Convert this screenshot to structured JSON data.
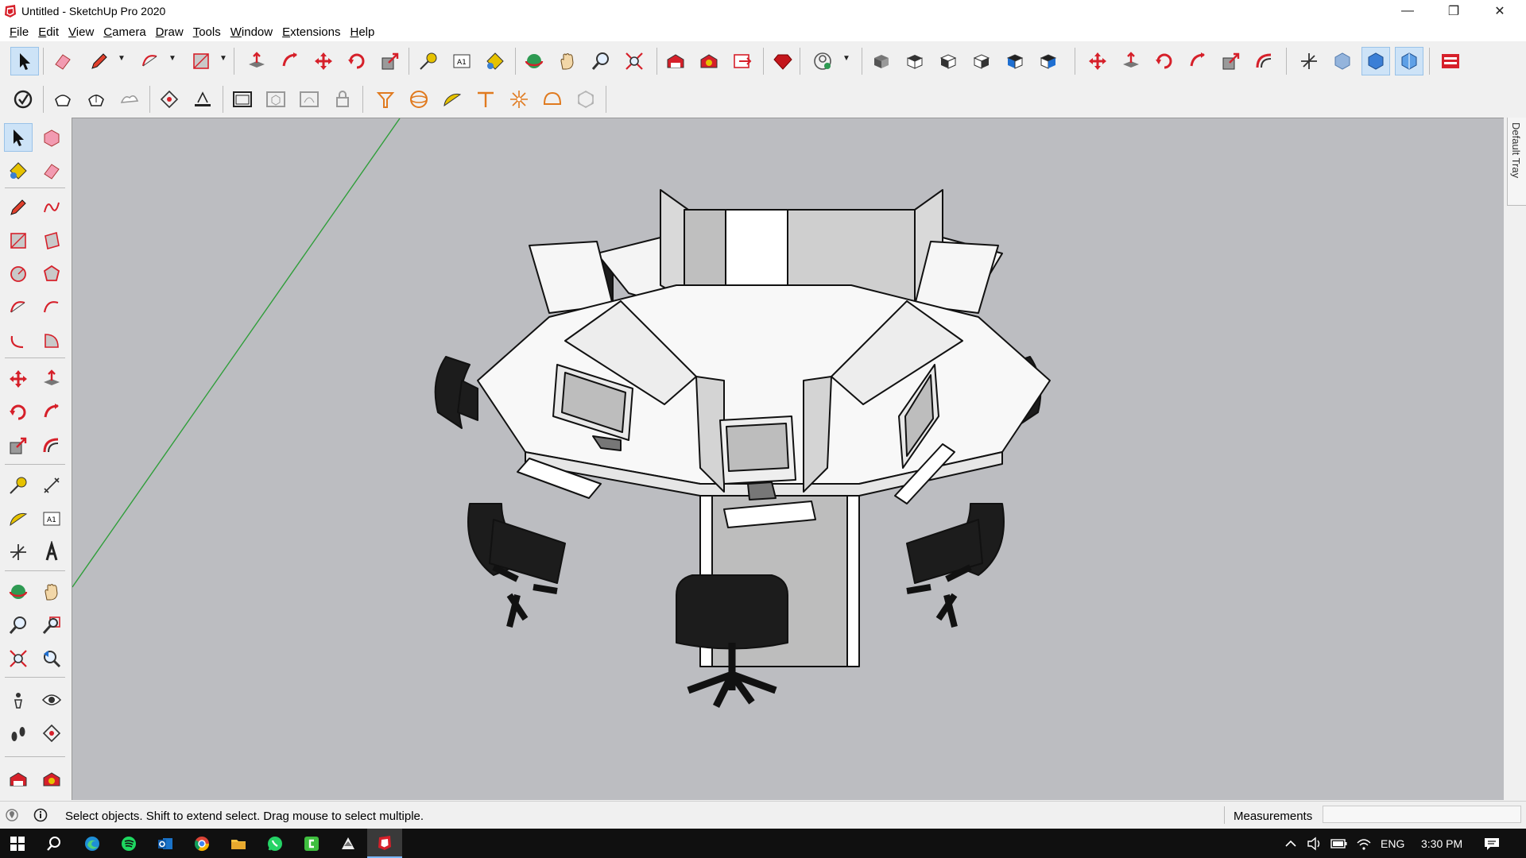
{
  "window": {
    "title": "Untitled - SketchUp Pro 2020",
    "minimize_glyph": "—",
    "restore_glyph": "❐",
    "close_glyph": "✕"
  },
  "menu": [
    "File",
    "Edit",
    "View",
    "Camera",
    "Draw",
    "Tools",
    "Window",
    "Extensions",
    "Help"
  ],
  "tray": {
    "label": "Default Tray"
  },
  "status": {
    "hint": "Select objects. Shift to extend select. Drag mouse to select multiple.",
    "measurements_label": "Measurements",
    "measurements_value": ""
  },
  "taskbar": {
    "language": "ENG",
    "time": "3:30 PM"
  },
  "colors": {
    "accent_red": "#d6202a",
    "viewport_bg": "#bcbdc1",
    "axis_green": "#2f9e3a",
    "orange_tool": "#e07a1f"
  },
  "icons": {
    "top_row_1": [
      "select-icon",
      "eraser-icon",
      "pencil-icon",
      "arc-icon",
      "rectangle-icon",
      "push-pull-icon",
      "follow-me-icon",
      "move-icon",
      "rotate-icon",
      "scale-icon",
      "tape-measure-icon",
      "text-icon",
      "paint-bucket-icon",
      "orbit-icon",
      "pan-icon",
      "zoom-icon",
      "zoom-extents-icon",
      "warehouse-icon",
      "extension-warehouse-icon",
      "send-to-layout-icon",
      "ruby-icon",
      "profile-icon",
      "view-iso-icon",
      "view-top-icon",
      "view-front-icon",
      "view-right-icon",
      "view-back-icon",
      "view-left-icon",
      "move-red-icon",
      "push-pull-red-icon",
      "rotate-red-icon",
      "follow-me-red-icon",
      "scale-red-icon",
      "offset-red-icon",
      "axes-icon",
      "xray-icon",
      "shaded-icon",
      "textured-icon",
      "layout-icon"
    ],
    "top_row_2": [
      "style-icon",
      "sandbox-smoove-icon",
      "sandbox-stamp-icon",
      "sandbox-drape-icon",
      "section-plane-icon",
      "section-cut-icon",
      "window-icon",
      "component-icon",
      "group-icon",
      "lock-icon",
      "advanced-camera-icon",
      "sphere-icon",
      "protractor-icon",
      "tee-icon",
      "light-icon",
      "dome-icon",
      "cube-icon"
    ],
    "left": [
      "select-icon",
      "make-component-icon",
      "paint-bucket-icon",
      "eraser-icon",
      "line-icon",
      "freehand-icon",
      "rectangle-icon",
      "rotated-rectangle-icon",
      "circle-icon",
      "polygon-icon",
      "arc-icon",
      "two-point-arc-icon",
      "three-point-arc-icon",
      "pie-icon",
      "move-icon",
      "push-pull-icon",
      "rotate-icon",
      "follow-me-icon",
      "scale-icon",
      "offset-icon",
      "tape-measure-icon",
      "dimension-icon",
      "protractor-icon",
      "text-icon",
      "axes-icon",
      "three-d-text-icon",
      "orbit-icon",
      "pan-icon",
      "zoom-icon",
      "zoom-window-icon",
      "zoom-extents-icon",
      "previous-view-icon",
      "position-camera-icon",
      "look-around-icon",
      "walk-icon",
      "section-plane-icon",
      "warehouse-icon",
      "extension-warehouse-icon"
    ],
    "taskbar": [
      "windows-start-icon",
      "search-icon",
      "edge-icon",
      "spotify-icon",
      "outlook-icon",
      "chrome-icon",
      "file-explorer-icon",
      "whatsapp-icon",
      "camtasia-icon",
      "inkscape-icon",
      "sketchup-icon"
    ]
  }
}
